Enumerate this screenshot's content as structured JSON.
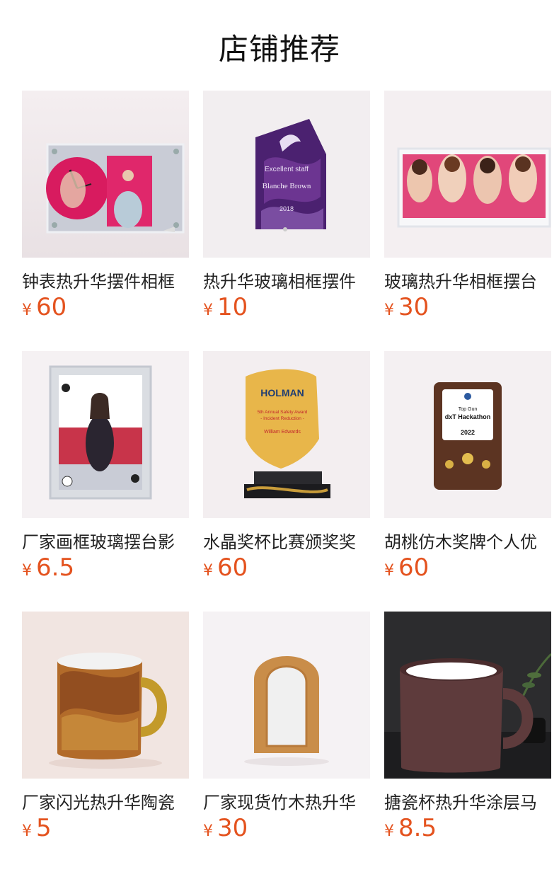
{
  "page": {
    "title": "店铺推荐"
  },
  "products": [
    {
      "name": "钟表热升华摆件相框",
      "currency": "¥",
      "price": "60",
      "icon": "clock-photo-frame"
    },
    {
      "name": "热升华玻璃相框摆件",
      "currency": "¥",
      "price": "10",
      "icon": "purple-glass-award"
    },
    {
      "name": "玻璃热升华相框摆台",
      "currency": "¥",
      "price": "30",
      "icon": "glass-photo-panel"
    },
    {
      "name": "厂家画框玻璃摆台影",
      "currency": "¥",
      "price": "6.5",
      "icon": "portrait-glass-frame"
    },
    {
      "name": "水晶奖杯比赛颁奖奖",
      "currency": "¥",
      "price": "60",
      "icon": "crystal-trophy"
    },
    {
      "name": "胡桃仿木奖牌个人优",
      "currency": "¥",
      "price": "60",
      "icon": "walnut-plaque"
    },
    {
      "name": "厂家闪光热升华陶瓷",
      "currency": "¥",
      "price": "5",
      "icon": "glitter-mug"
    },
    {
      "name": "厂家现货竹木热升华",
      "currency": "¥",
      "price": "30",
      "icon": "bamboo-frame"
    },
    {
      "name": "搪瓷杯热升华涂层马",
      "currency": "¥",
      "price": "8.5",
      "icon": "enamel-mug"
    }
  ],
  "image_text": {
    "award_purple": [
      "Excellent staff",
      "Blanche Brown",
      "2018"
    ],
    "trophy": [
      "HOLMAN",
      "5th Annual Safety Award",
      "- Incident Reduction -",
      "William Edwards"
    ],
    "plaque": [
      "Top Gun",
      "dxT Hackathon",
      "2022"
    ]
  },
  "colors": {
    "price": "#e4531f",
    "title": "#111111"
  }
}
